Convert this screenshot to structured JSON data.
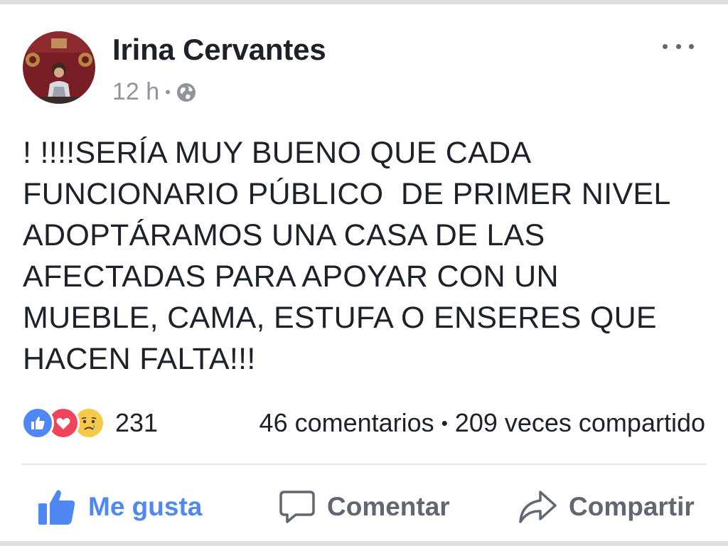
{
  "post": {
    "author": "Irina Cervantes",
    "time": "12 h",
    "privacy_icon": "globe-icon",
    "text": "! !!!!SERÍA MUY BUENO QUE CADA\nFUNCIONARIO PÚBLICO  DE PRIMER NIVEL\nADOPTÁRAMOS UNA CASA DE LAS\nAFECTADAS PARA APOYAR CON UN\nMUEBLE, CAMA, ESTUFA O ENSERES QUE\nHACEN FALTA!!!"
  },
  "reactions": {
    "icons": [
      "like-reaction-icon",
      "love-reaction-icon",
      "sad-reaction-icon"
    ],
    "count": "231"
  },
  "stats": {
    "comments": "46 comentarios",
    "shares": "209 veces compartido"
  },
  "actions": {
    "like_label": "Me gusta",
    "comment_label": "Comentar",
    "share_label": "Compartir"
  },
  "colors": {
    "accent": "#4f88f3",
    "love": "#f0445c",
    "sad": "#f7c94b",
    "text": "#1d2129",
    "muted": "#90949c"
  }
}
